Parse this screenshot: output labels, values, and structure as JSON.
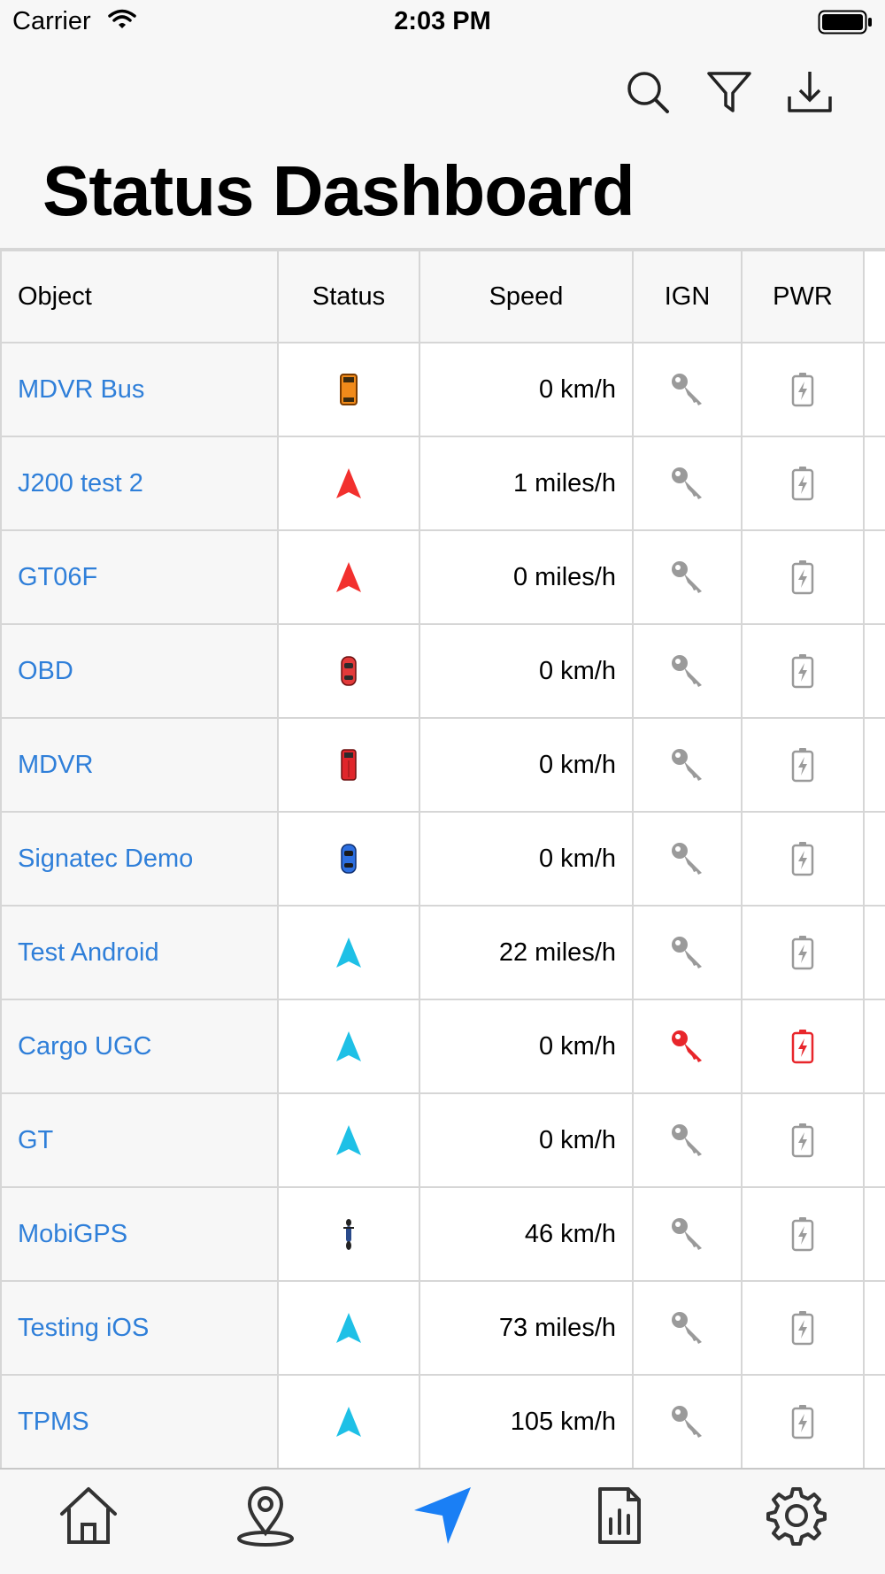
{
  "status_bar": {
    "carrier": "Carrier",
    "time": "2:03 PM"
  },
  "header": {
    "title": "Status Dashboard"
  },
  "toolbar": {
    "icons": [
      "search-icon",
      "filter-icon",
      "download-icon"
    ]
  },
  "table": {
    "columns": [
      "Object",
      "Status",
      "Speed",
      "IGN",
      "PWR"
    ],
    "rows": [
      {
        "object": "MDVR Bus",
        "status_icon": "bus-icon",
        "speed": "0 km/h",
        "ign_color": "#9a9a9a",
        "pwr_color": "#9a9a9a"
      },
      {
        "object": "J200 test 2",
        "status_icon": "arrow-red-icon",
        "speed": "1 miles/h",
        "ign_color": "#9a9a9a",
        "pwr_color": "#9a9a9a"
      },
      {
        "object": "GT06F",
        "status_icon": "arrow-red-icon",
        "speed": "0 miles/h",
        "ign_color": "#9a9a9a",
        "pwr_color": "#9a9a9a"
      },
      {
        "object": "OBD",
        "status_icon": "car-red-icon",
        "speed": "0 km/h",
        "ign_color": "#9a9a9a",
        "pwr_color": "#9a9a9a"
      },
      {
        "object": "MDVR",
        "status_icon": "truck-red-icon",
        "speed": "0 km/h",
        "ign_color": "#9a9a9a",
        "pwr_color": "#9a9a9a"
      },
      {
        "object": "Signatec Demo",
        "status_icon": "car-blue-icon",
        "speed": "0 km/h",
        "ign_color": "#9a9a9a",
        "pwr_color": "#9a9a9a"
      },
      {
        "object": "Test Android",
        "status_icon": "arrow-cyan-icon",
        "speed": "22 miles/h",
        "ign_color": "#9a9a9a",
        "pwr_color": "#9a9a9a"
      },
      {
        "object": "Cargo UGC",
        "status_icon": "arrow-cyan-icon",
        "speed": "0 km/h",
        "ign_color": "#e8262b",
        "pwr_color": "#e8262b"
      },
      {
        "object": "GT",
        "status_icon": "arrow-cyan-icon",
        "speed": "0 km/h",
        "ign_color": "#9a9a9a",
        "pwr_color": "#9a9a9a"
      },
      {
        "object": "MobiGPS",
        "status_icon": "motorcycle-icon",
        "speed": "46 km/h",
        "ign_color": "#9a9a9a",
        "pwr_color": "#9a9a9a"
      },
      {
        "object": "Testing iOS",
        "status_icon": "arrow-cyan-icon",
        "speed": "73 miles/h",
        "ign_color": "#9a9a9a",
        "pwr_color": "#9a9a9a"
      },
      {
        "object": "TPMS",
        "status_icon": "arrow-cyan-icon",
        "speed": "105 km/h",
        "ign_color": "#9a9a9a",
        "pwr_color": "#9a9a9a"
      }
    ]
  },
  "tab_bar": {
    "tabs": [
      {
        "icon": "home-icon",
        "active": false
      },
      {
        "icon": "map-pin-icon",
        "active": false
      },
      {
        "icon": "navigation-arrow-icon",
        "active": true
      },
      {
        "icon": "report-icon",
        "active": false
      },
      {
        "icon": "settings-gear-icon",
        "active": false
      }
    ]
  },
  "colors": {
    "link": "#2f7fd9",
    "active_tab": "#1a7ff5",
    "inactive_tab": "#333333",
    "alert": "#e8262b"
  }
}
